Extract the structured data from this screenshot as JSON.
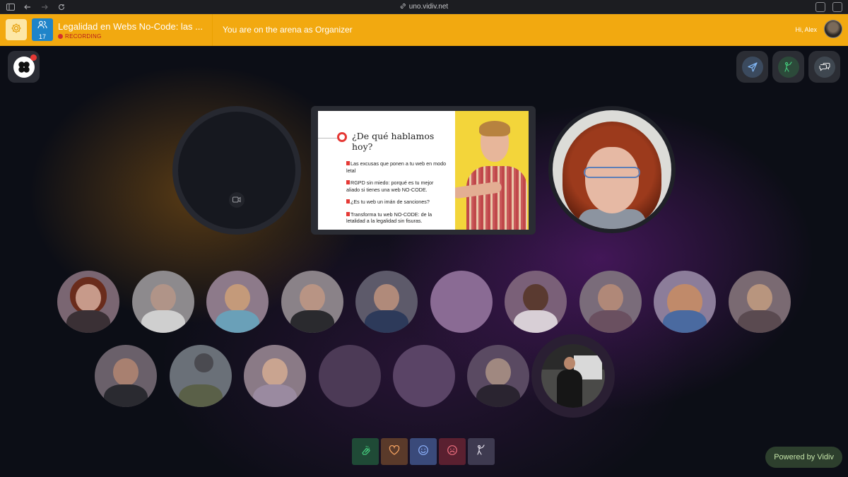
{
  "browser": {
    "url": "uno.vidiv.net"
  },
  "topbar": {
    "participant_count": "17",
    "event_title": "Legalidad en Webs No-Code: las ...",
    "recording_label": "RECORDING",
    "arena_message": "You are on the arena as Organizer",
    "greeting": "Hi, Alex"
  },
  "slide": {
    "heading": "¿De qué hablamos hoy?",
    "bullets": [
      "Las excusas que ponen a tu web en modo letal",
      "RGPD sin miedo: porqué es tu mejor aliado si tienes una web NO-CODE.",
      "¿Es tu web un imán de sanciones?",
      "Transforma tu web NO-CODE: de la letalidad a la legalidad sin fisuras."
    ]
  },
  "footer": {
    "powered_by": "Powered by Vidiv"
  },
  "colors": {
    "topbar": "#f2a910",
    "accent_blue": "#1f84c9",
    "recording_red": "#d32f2f"
  }
}
